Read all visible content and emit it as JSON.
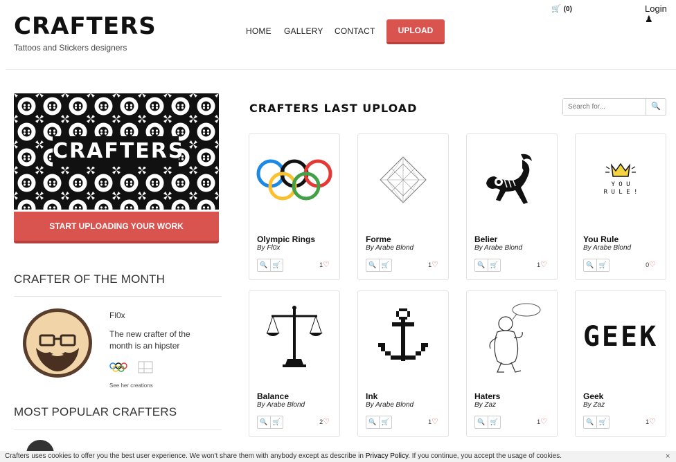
{
  "header": {
    "logo": "CRAFTERS",
    "tagline": "Tattoos and Stickers designers",
    "nav": [
      "HOME",
      "GALLERY",
      "CONTACT"
    ],
    "upload": "UPLOAD",
    "cart_count": "(0)",
    "login": "Login"
  },
  "sidebar": {
    "banner_text": "CRAFTERS",
    "start_button": "START UPLOADING YOUR WORK",
    "crafter_of_month_title": "CRAFTER OF THE MONTH",
    "crafter": {
      "name": "Fl0x",
      "description": "The new crafter of the month is an hipster",
      "see_creations": "See her creations"
    },
    "most_popular_title": "MOST POPULAR CRAFTERS"
  },
  "main": {
    "title": "CRAFTERS LAST UPLOAD",
    "search_placeholder": "Search for...",
    "cards": [
      {
        "title": "Olympic Rings",
        "author": "By Fl0x",
        "likes": "1"
      },
      {
        "title": "Forme",
        "author": "By Arabe Blond",
        "likes": "1"
      },
      {
        "title": "Belier",
        "author": "By Arabe Blond",
        "likes": "1"
      },
      {
        "title": "You Rule",
        "author": "By Arabe Blond",
        "likes": "0"
      },
      {
        "title": "Balance",
        "author": "By Arabe Blond",
        "likes": "2"
      },
      {
        "title": "Ink",
        "author": "By Arabe Blond",
        "likes": "1"
      },
      {
        "title": "Haters",
        "author": "By Zaz",
        "likes": "1"
      },
      {
        "title": "Geek",
        "author": "By Zaz",
        "likes": "1"
      }
    ],
    "youRule_text": "YOU RULE!",
    "geek_text": "GEEK"
  },
  "cookie": {
    "text_before": "Crafters uses cookies to offer you the best user experience. We won't share them with anybody except as describe in ",
    "policy": "Privacy Policy",
    "text_after": ". If you continue, you accept the usage of cookies.",
    "close": "×"
  },
  "colors": {
    "accent": "#d9534f",
    "heart": "#e0524b"
  }
}
